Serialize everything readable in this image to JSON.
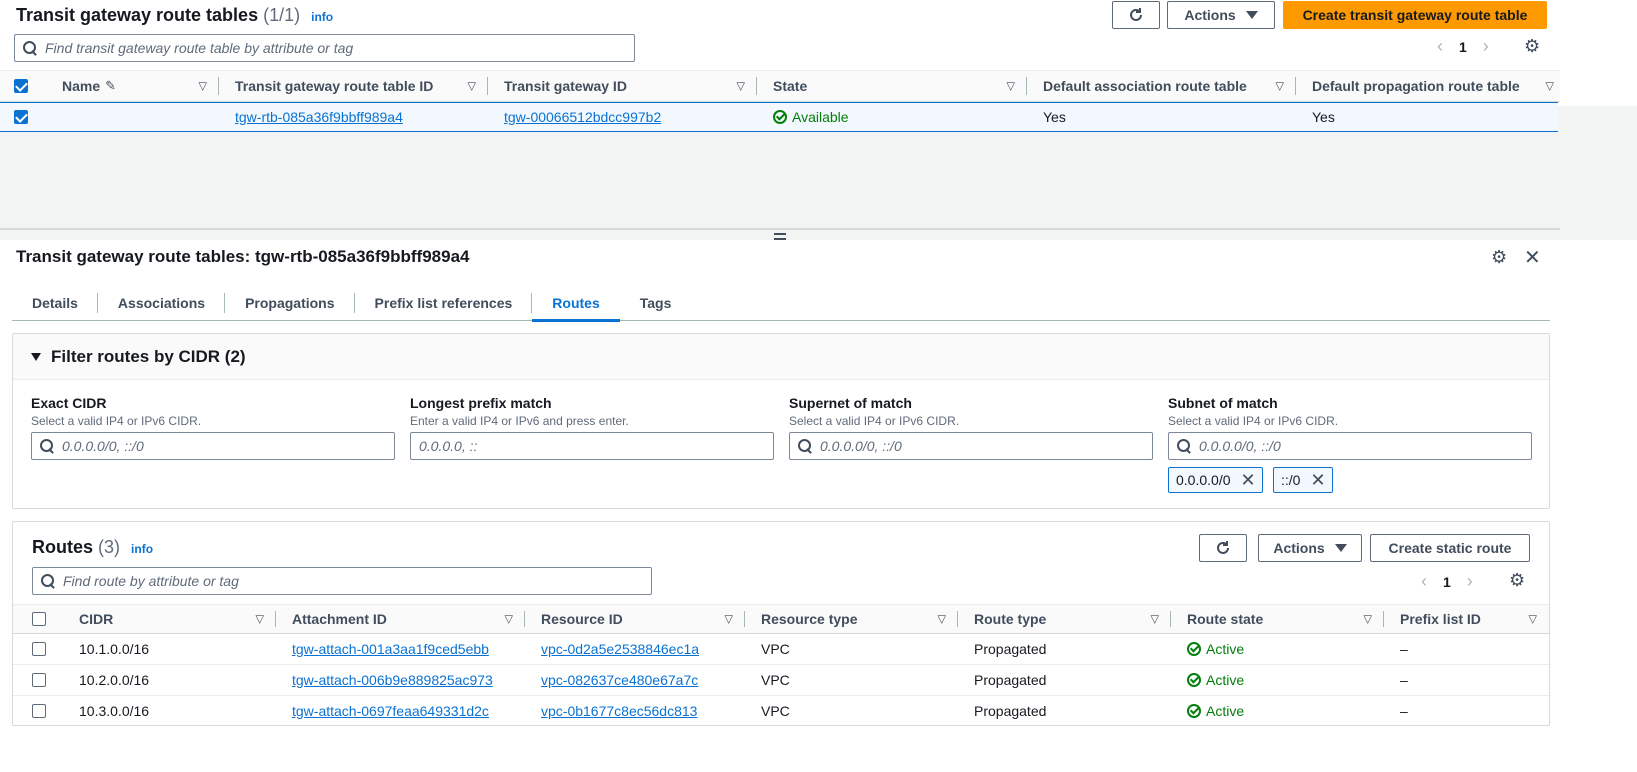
{
  "top": {
    "title": "Transit gateway route tables",
    "count": "(1/1)",
    "info": "info",
    "actions_label": "Actions",
    "create_label": "Create transit gateway route table",
    "search_placeholder": "Find transit gateway route table by attribute or tag",
    "page": "1",
    "columns": [
      "Name",
      "Transit gateway route table ID",
      "Transit gateway ID",
      "State",
      "Default association route table",
      "Default propagation route table"
    ],
    "rows": [
      {
        "name": "",
        "route_table_id": "tgw-rtb-085a36f9bbff989a4",
        "tgw_id": "tgw-00066512bdcc997b2",
        "state": "Available",
        "default_assoc": "Yes",
        "default_prop": "Yes"
      }
    ]
  },
  "details": {
    "title": "Transit gateway route tables: tgw-rtb-085a36f9bbff989a4",
    "tabs": [
      "Details",
      "Associations",
      "Propagations",
      "Prefix list references",
      "Routes",
      "Tags"
    ],
    "active_tab": "Routes",
    "filter": {
      "title": "Filter routes by CIDR (2)",
      "fields": [
        {
          "label": "Exact CIDR",
          "desc": "Select a valid IP4 or IPv6 CIDR.",
          "placeholder": "0.0.0.0/0, ::/0"
        },
        {
          "label": "Longest prefix match",
          "desc": "Enter a valid IP4 or IPv6 and press enter.",
          "placeholder": "0.0.0.0, ::"
        },
        {
          "label": "Supernet of match",
          "desc": "Select a valid IP4 or IPv6 CIDR.",
          "placeholder": "0.0.0.0/0, ::/0"
        },
        {
          "label": "Subnet of match",
          "desc": "Select a valid IP4 or IPv6 CIDR.",
          "placeholder": "0.0.0.0/0, ::/0"
        }
      ],
      "tokens": [
        "0.0.0.0/0",
        "::/0"
      ]
    },
    "routes": {
      "title": "Routes",
      "count": "(3)",
      "info": "info",
      "actions_label": "Actions",
      "create_label": "Create static route",
      "search_placeholder": "Find route by attribute or tag",
      "page": "1",
      "columns": [
        "CIDR",
        "Attachment ID",
        "Resource ID",
        "Resource type",
        "Route type",
        "Route state",
        "Prefix list ID"
      ],
      "rows": [
        {
          "cidr": "10.1.0.0/16",
          "attachment": "tgw-attach-001a3aa1f9ced5ebb",
          "resource": "vpc-0d2a5e2538846ec1a",
          "rtype": "VPC",
          "route_type": "Propagated",
          "state": "Active",
          "prefix": "–"
        },
        {
          "cidr": "10.2.0.0/16",
          "attachment": "tgw-attach-006b9e889825ac973",
          "resource": "vpc-082637ce480e67a7c",
          "rtype": "VPC",
          "route_type": "Propagated",
          "state": "Active",
          "prefix": "–"
        },
        {
          "cidr": "10.3.0.0/16",
          "attachment": "tgw-attach-0697feaa649331d2c",
          "resource": "vpc-0b1677c8ec56dc813",
          "rtype": "VPC",
          "route_type": "Propagated",
          "state": "Active",
          "prefix": "–"
        }
      ]
    }
  }
}
